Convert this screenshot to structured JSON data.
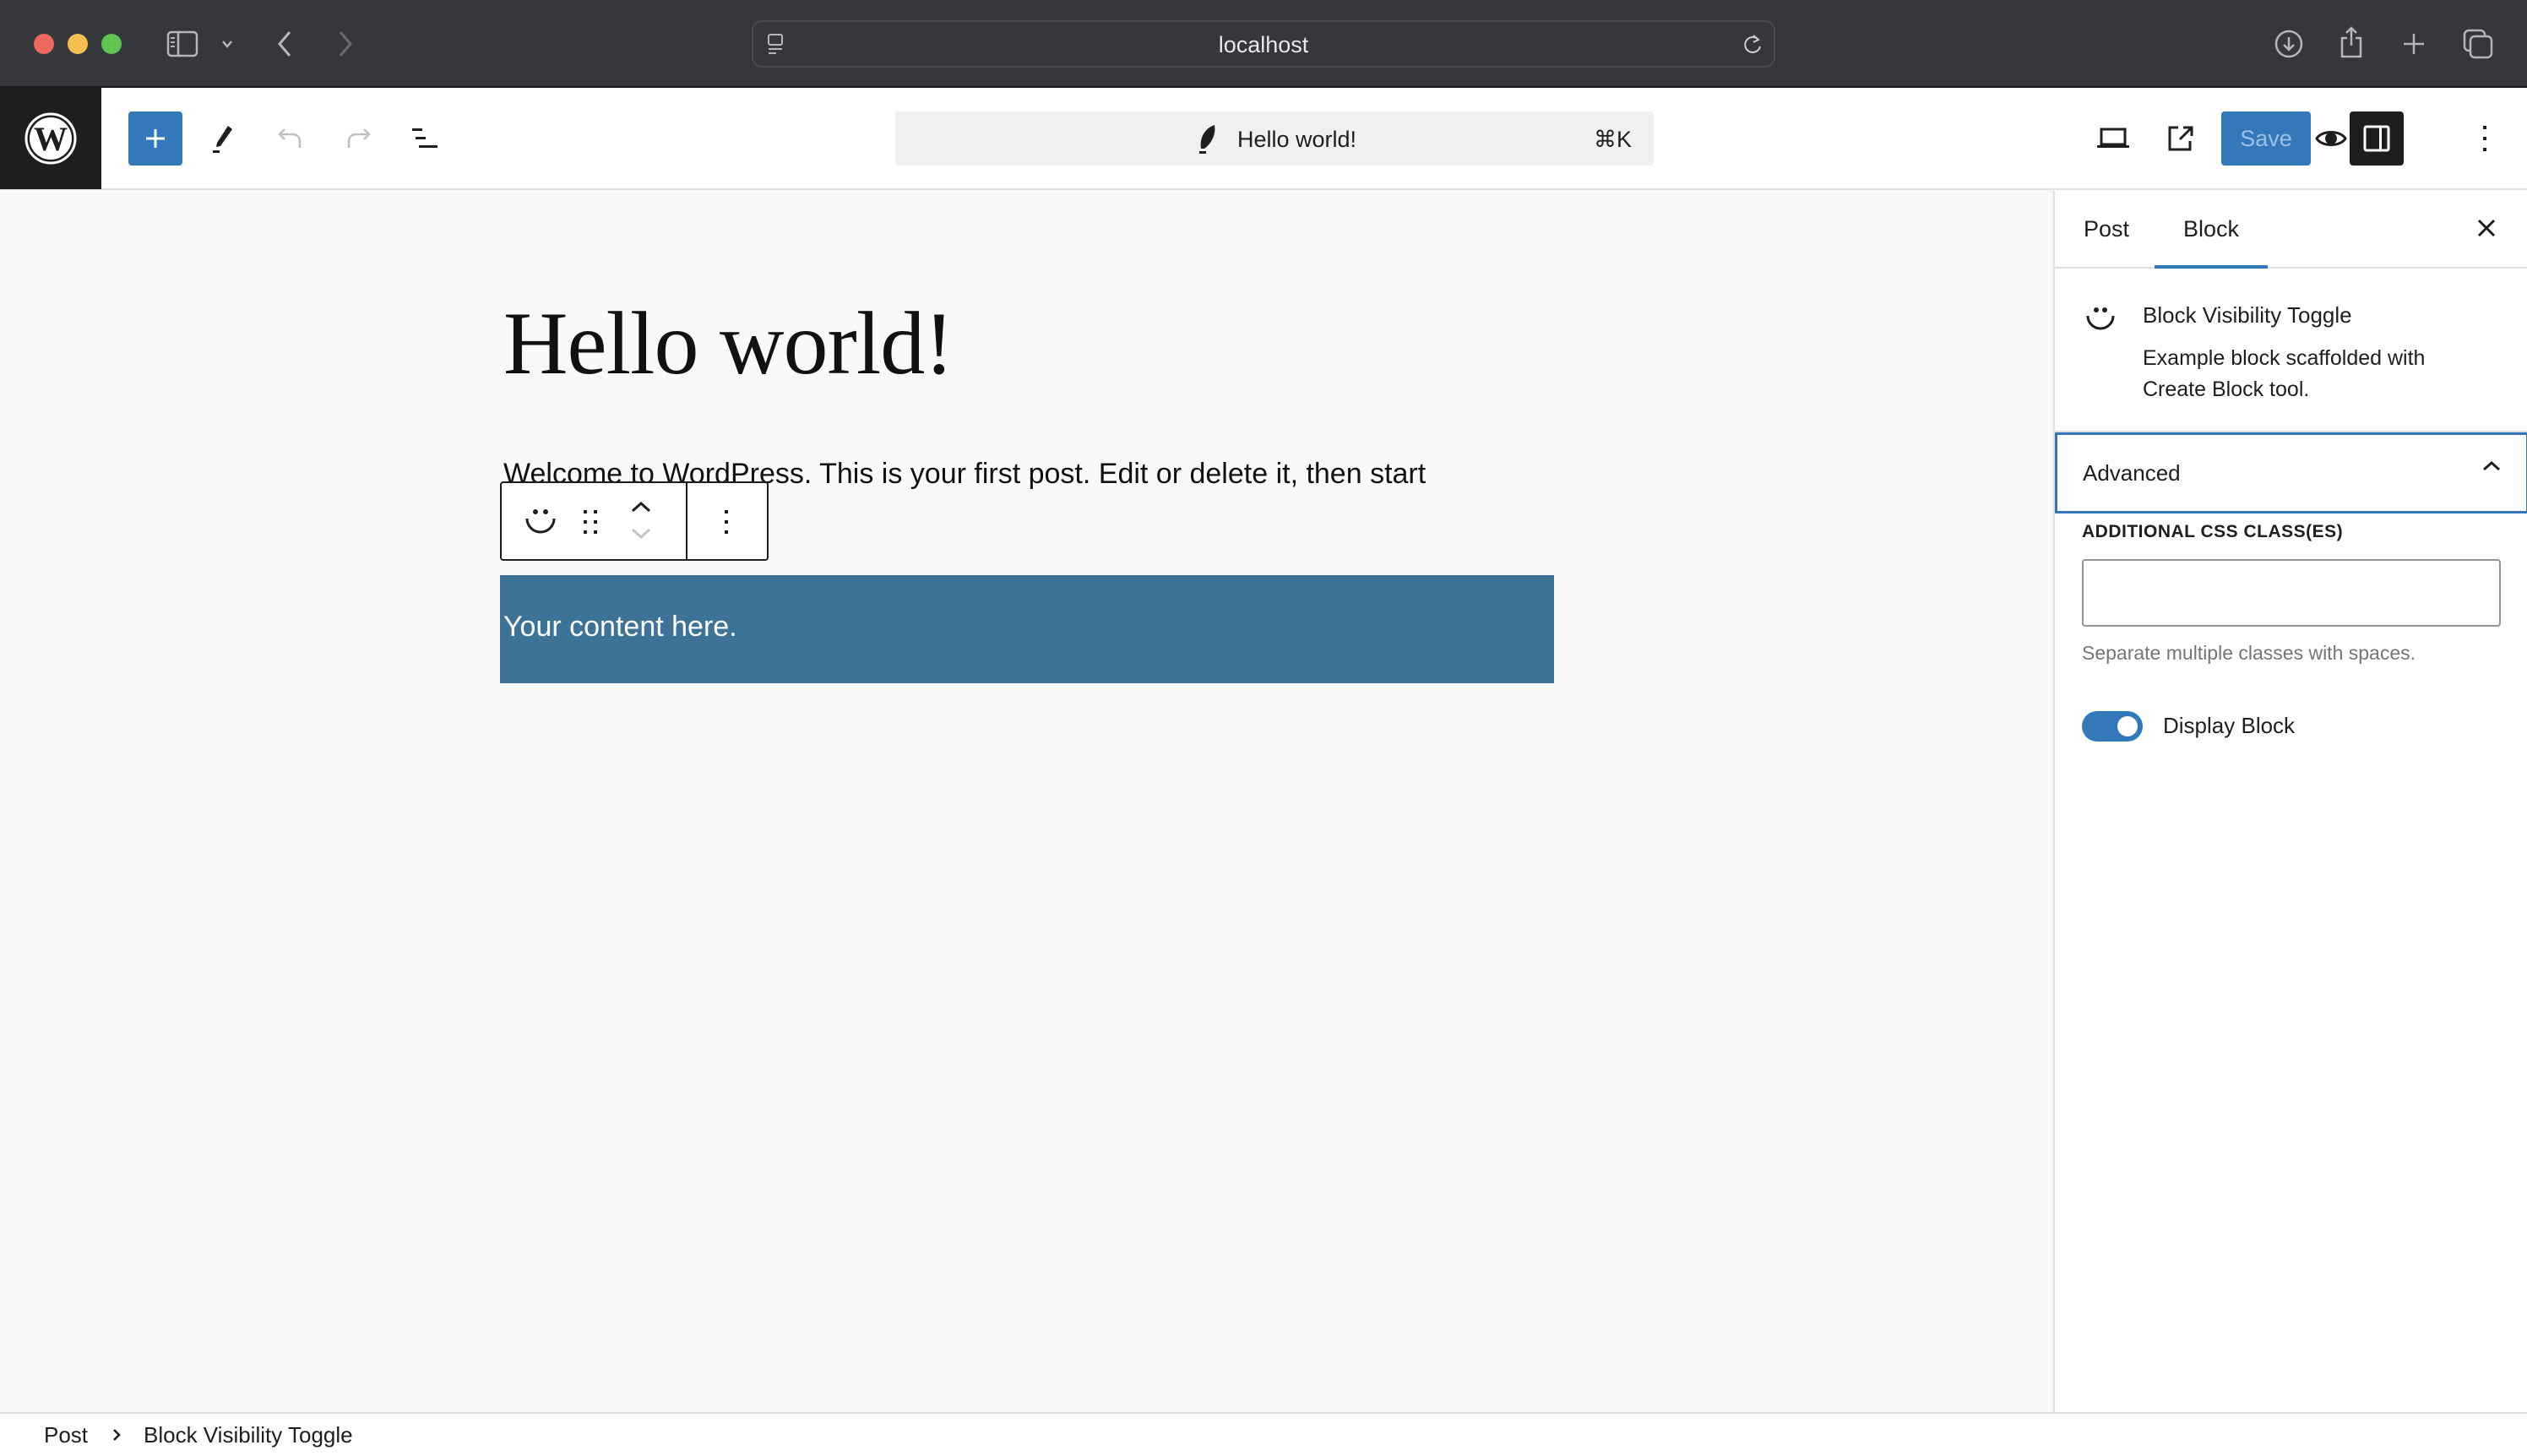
{
  "browser": {
    "url": "localhost",
    "colors": {
      "close": "#ec6a5e",
      "minimize": "#f4bf4f",
      "maximize": "#61c554"
    }
  },
  "toolbar": {
    "document_title": "Hello world!",
    "shortcut": "⌘K",
    "save_label": "Save",
    "accent": "#3378b8"
  },
  "editor": {
    "post_title": "Hello world!",
    "paragraph": "Welcome to WordPress. This is your first post. Edit or delete it, then start",
    "content_block_text": "Your content here.",
    "content_block_color": "#3c7397"
  },
  "sidebar": {
    "tabs": [
      {
        "label": "Post",
        "active": false
      },
      {
        "label": "Block",
        "active": true
      }
    ],
    "block_card": {
      "title": "Block Visibility Toggle",
      "description": "Example block scaffolded with Create Block tool."
    },
    "advanced": {
      "label": "Advanced",
      "expanded": true,
      "css_label": "ADDITIONAL CSS CLASS(ES)",
      "css_value": "",
      "help": "Separate multiple classes with spaces."
    },
    "display_toggle": {
      "label": "Display Block",
      "checked": true
    }
  },
  "breadcrumb": [
    "Post",
    "Block Visibility Toggle"
  ]
}
